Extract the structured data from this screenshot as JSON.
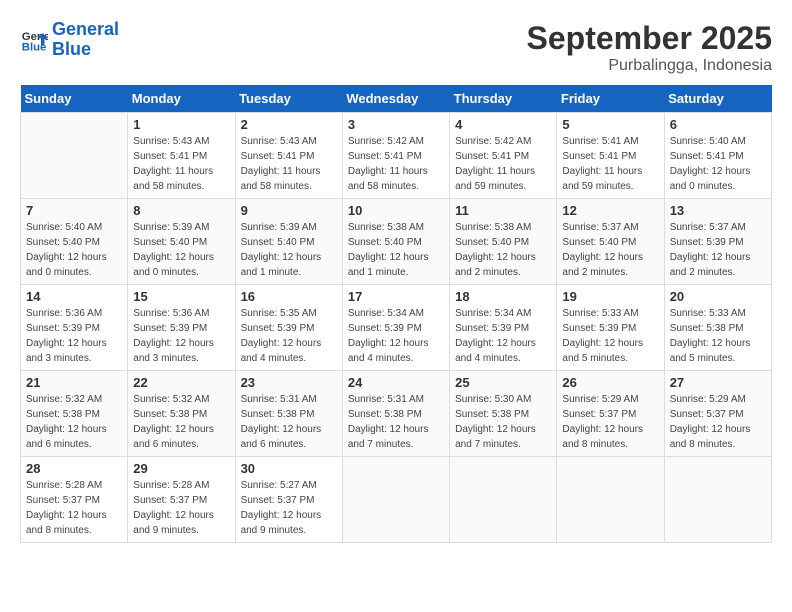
{
  "header": {
    "logo_line1": "General",
    "logo_line2": "Blue",
    "month": "September 2025",
    "location": "Purbalingga, Indonesia"
  },
  "weekdays": [
    "Sunday",
    "Monday",
    "Tuesday",
    "Wednesday",
    "Thursday",
    "Friday",
    "Saturday"
  ],
  "weeks": [
    [
      {
        "day": "",
        "empty": true
      },
      {
        "day": "1",
        "sunrise": "5:43 AM",
        "sunset": "5:41 PM",
        "daylight": "11 hours and 58 minutes."
      },
      {
        "day": "2",
        "sunrise": "5:43 AM",
        "sunset": "5:41 PM",
        "daylight": "11 hours and 58 minutes."
      },
      {
        "day": "3",
        "sunrise": "5:42 AM",
        "sunset": "5:41 PM",
        "daylight": "11 hours and 58 minutes."
      },
      {
        "day": "4",
        "sunrise": "5:42 AM",
        "sunset": "5:41 PM",
        "daylight": "11 hours and 59 minutes."
      },
      {
        "day": "5",
        "sunrise": "5:41 AM",
        "sunset": "5:41 PM",
        "daylight": "11 hours and 59 minutes."
      },
      {
        "day": "6",
        "sunrise": "5:40 AM",
        "sunset": "5:41 PM",
        "daylight": "12 hours and 0 minutes."
      }
    ],
    [
      {
        "day": "7",
        "sunrise": "5:40 AM",
        "sunset": "5:40 PM",
        "daylight": "12 hours and 0 minutes."
      },
      {
        "day": "8",
        "sunrise": "5:39 AM",
        "sunset": "5:40 PM",
        "daylight": "12 hours and 0 minutes."
      },
      {
        "day": "9",
        "sunrise": "5:39 AM",
        "sunset": "5:40 PM",
        "daylight": "12 hours and 1 minute."
      },
      {
        "day": "10",
        "sunrise": "5:38 AM",
        "sunset": "5:40 PM",
        "daylight": "12 hours and 1 minute."
      },
      {
        "day": "11",
        "sunrise": "5:38 AM",
        "sunset": "5:40 PM",
        "daylight": "12 hours and 2 minutes."
      },
      {
        "day": "12",
        "sunrise": "5:37 AM",
        "sunset": "5:40 PM",
        "daylight": "12 hours and 2 minutes."
      },
      {
        "day": "13",
        "sunrise": "5:37 AM",
        "sunset": "5:39 PM",
        "daylight": "12 hours and 2 minutes."
      }
    ],
    [
      {
        "day": "14",
        "sunrise": "5:36 AM",
        "sunset": "5:39 PM",
        "daylight": "12 hours and 3 minutes."
      },
      {
        "day": "15",
        "sunrise": "5:36 AM",
        "sunset": "5:39 PM",
        "daylight": "12 hours and 3 minutes."
      },
      {
        "day": "16",
        "sunrise": "5:35 AM",
        "sunset": "5:39 PM",
        "daylight": "12 hours and 4 minutes."
      },
      {
        "day": "17",
        "sunrise": "5:34 AM",
        "sunset": "5:39 PM",
        "daylight": "12 hours and 4 minutes."
      },
      {
        "day": "18",
        "sunrise": "5:34 AM",
        "sunset": "5:39 PM",
        "daylight": "12 hours and 4 minutes."
      },
      {
        "day": "19",
        "sunrise": "5:33 AM",
        "sunset": "5:39 PM",
        "daylight": "12 hours and 5 minutes."
      },
      {
        "day": "20",
        "sunrise": "5:33 AM",
        "sunset": "5:38 PM",
        "daylight": "12 hours and 5 minutes."
      }
    ],
    [
      {
        "day": "21",
        "sunrise": "5:32 AM",
        "sunset": "5:38 PM",
        "daylight": "12 hours and 6 minutes."
      },
      {
        "day": "22",
        "sunrise": "5:32 AM",
        "sunset": "5:38 PM",
        "daylight": "12 hours and 6 minutes."
      },
      {
        "day": "23",
        "sunrise": "5:31 AM",
        "sunset": "5:38 PM",
        "daylight": "12 hours and 6 minutes."
      },
      {
        "day": "24",
        "sunrise": "5:31 AM",
        "sunset": "5:38 PM",
        "daylight": "12 hours and 7 minutes."
      },
      {
        "day": "25",
        "sunrise": "5:30 AM",
        "sunset": "5:38 PM",
        "daylight": "12 hours and 7 minutes."
      },
      {
        "day": "26",
        "sunrise": "5:29 AM",
        "sunset": "5:37 PM",
        "daylight": "12 hours and 8 minutes."
      },
      {
        "day": "27",
        "sunrise": "5:29 AM",
        "sunset": "5:37 PM",
        "daylight": "12 hours and 8 minutes."
      }
    ],
    [
      {
        "day": "28",
        "sunrise": "5:28 AM",
        "sunset": "5:37 PM",
        "daylight": "12 hours and 8 minutes."
      },
      {
        "day": "29",
        "sunrise": "5:28 AM",
        "sunset": "5:37 PM",
        "daylight": "12 hours and 9 minutes."
      },
      {
        "day": "30",
        "sunrise": "5:27 AM",
        "sunset": "5:37 PM",
        "daylight": "12 hours and 9 minutes."
      },
      {
        "day": "",
        "empty": true
      },
      {
        "day": "",
        "empty": true
      },
      {
        "day": "",
        "empty": true
      },
      {
        "day": "",
        "empty": true
      }
    ]
  ]
}
